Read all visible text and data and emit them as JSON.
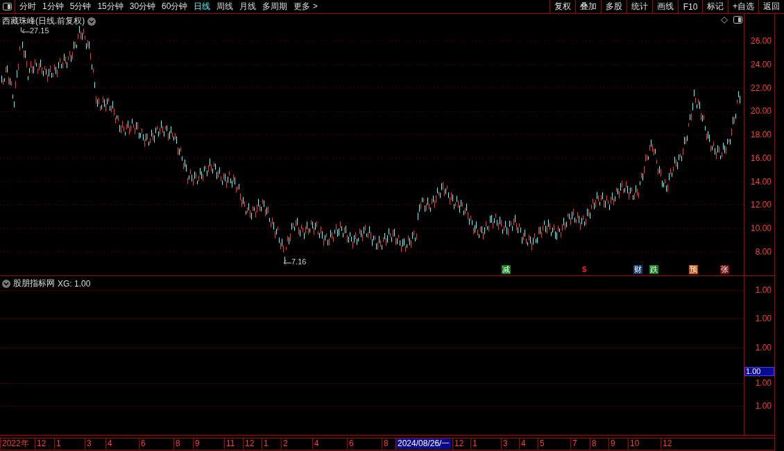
{
  "toolbar": {
    "periods": [
      {
        "label": "分时",
        "selected": false
      },
      {
        "label": "1分钟",
        "selected": false
      },
      {
        "label": "5分钟",
        "selected": false
      },
      {
        "label": "15分钟",
        "selected": false
      },
      {
        "label": "30分钟",
        "selected": false
      },
      {
        "label": "60分钟",
        "selected": false
      },
      {
        "label": "日线",
        "selected": true
      },
      {
        "label": "周线",
        "selected": false
      },
      {
        "label": "月线",
        "selected": false
      },
      {
        "label": "多周期",
        "selected": false
      },
      {
        "label": "更多 >",
        "selected": false
      }
    ],
    "buttons": [
      "复权",
      "叠加",
      "多股",
      "统计",
      "画线",
      "F10",
      "标记",
      "+自选",
      "返回"
    ]
  },
  "main_chart": {
    "title": "西藏珠峰(日线.前复权)",
    "high_label": "27.15",
    "low_label": "7.16",
    "y_labels": [
      "26.00",
      "24.00",
      "22.00",
      "20.00",
      "18.00",
      "16.00",
      "14.00",
      "12.00",
      "10.00",
      "8.00"
    ],
    "events": [
      {
        "label": "减",
        "kind": "badge",
        "color": "#12801a"
      },
      {
        "label": "$",
        "kind": "text",
        "color": "#ff2020"
      },
      {
        "label": "财",
        "kind": "badge",
        "color": "#153f78"
      },
      {
        "label": "跌",
        "kind": "badge",
        "color": "#12801a"
      },
      {
        "label": "预",
        "kind": "badge",
        "color": "#c5520f"
      },
      {
        "label": "张",
        "kind": "badge",
        "color": "#741010"
      }
    ]
  },
  "indicator": {
    "name": "股朋指标网",
    "reading": "XG: 1.00",
    "y_labels": [
      "1.00",
      "1.00",
      "1.00",
      "1.00",
      "1.00"
    ],
    "cursor_value": "1.00"
  },
  "time_axis": {
    "labels": [
      {
        "label": "2022年",
        "selected": false
      },
      {
        "label": "12",
        "selected": false
      },
      {
        "label": "1",
        "selected": false
      },
      {
        "label": "3",
        "selected": false
      },
      {
        "label": "4",
        "selected": false
      },
      {
        "label": "6",
        "selected": false
      },
      {
        "label": "8",
        "selected": false
      },
      {
        "label": "9",
        "selected": false
      },
      {
        "label": "11",
        "selected": false
      },
      {
        "label": "12",
        "selected": false
      },
      {
        "label": "1",
        "selected": false
      },
      {
        "label": "2",
        "selected": false
      },
      {
        "label": "4",
        "selected": false
      },
      {
        "label": "6",
        "selected": false
      },
      {
        "label": "8",
        "selected": false
      },
      {
        "label": "2024/08/26/一",
        "selected": true
      },
      {
        "label": "12",
        "selected": false
      },
      {
        "label": "1",
        "selected": false
      },
      {
        "label": "3",
        "selected": false
      },
      {
        "label": "4",
        "selected": false
      },
      {
        "label": "5",
        "selected": false
      },
      {
        "label": "7",
        "selected": false
      },
      {
        "label": "8",
        "selected": false
      },
      {
        "label": "9",
        "selected": false
      },
      {
        "label": "10",
        "selected": false
      },
      {
        "label": "12",
        "selected": false
      }
    ]
  }
}
